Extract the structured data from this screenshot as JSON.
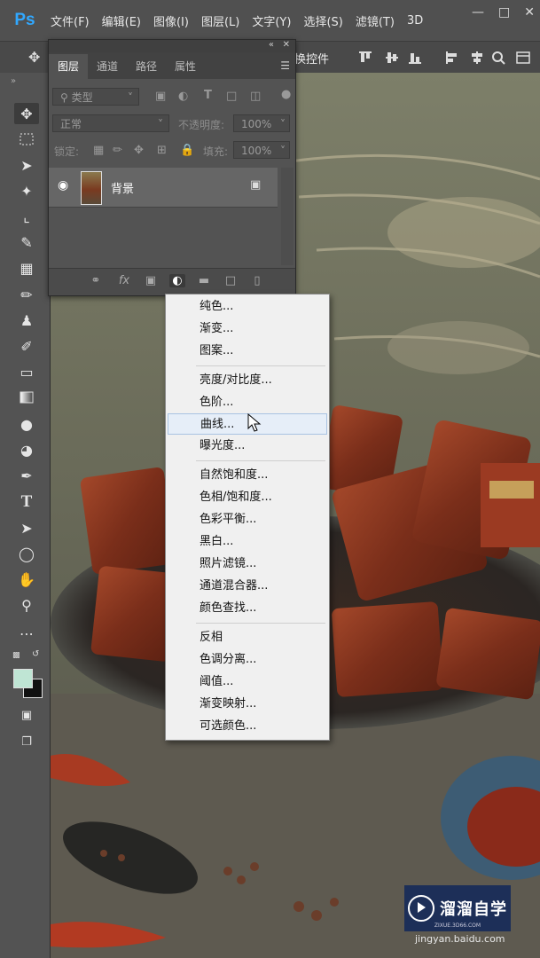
{
  "app": {
    "logo": "Ps"
  },
  "menubar": {
    "items": [
      "文件(F)",
      "编辑(E)",
      "图像(I)",
      "图层(L)",
      "文字(Y)",
      "选择(S)",
      "滤镜(T)",
      "3D"
    ],
    "window_controls": [
      "minimize-icon",
      "maximize-icon",
      "close-icon"
    ]
  },
  "options_bar": {
    "show_transform_controls": "换控件"
  },
  "toolbar": {
    "tools": [
      "move-icon",
      "marquee-icon",
      "lasso-icon",
      "magic-wand-icon",
      "crop-icon",
      "eyedropper-icon",
      "healing-icon",
      "brush-icon",
      "stamp-icon",
      "history-brush-icon",
      "eraser-icon",
      "gradient-icon",
      "blur-icon",
      "dodge-icon",
      "pen-icon",
      "type-icon",
      "path-select-icon",
      "ellipse-icon",
      "hand-icon",
      "zoom-icon",
      "more-icon"
    ],
    "foreground_color": "#bfe5d4",
    "background_color": "#111111"
  },
  "layers_panel": {
    "tabs": [
      "图层",
      "通道",
      "路径",
      "属性"
    ],
    "active_tab": "图层",
    "filter_type": "类型",
    "blend_mode": "正常",
    "opacity_label": "不透明度:",
    "opacity_value": "100%",
    "lock_label": "锁定:",
    "fill_label": "填充:",
    "fill_value": "100%",
    "layer": {
      "name": "背景",
      "visible": true,
      "locked": true
    },
    "footer_icons": [
      "link-icon",
      "fx-icon",
      "mask-icon",
      "adjustment-icon",
      "folder-icon",
      "new-layer-icon",
      "trash-icon"
    ]
  },
  "adjust_menu": {
    "groups": [
      [
        "纯色...",
        "渐变...",
        "图案..."
      ],
      [
        "亮度/对比度...",
        "色阶...",
        "曲线...",
        "曝光度..."
      ],
      [
        "自然饱和度...",
        "色相/饱和度...",
        "色彩平衡...",
        "黑白...",
        "照片滤镜...",
        "通道混合器...",
        "颜色查找..."
      ],
      [
        "反相",
        "色调分离...",
        "阈值...",
        "渐变映射...",
        "可选颜色..."
      ]
    ],
    "hovered": "曲线..."
  },
  "watermark": {
    "brand": "溜溜自学",
    "sub": "ZIXUE.3D66.COM",
    "credit": "jingyan.baidu.com"
  }
}
